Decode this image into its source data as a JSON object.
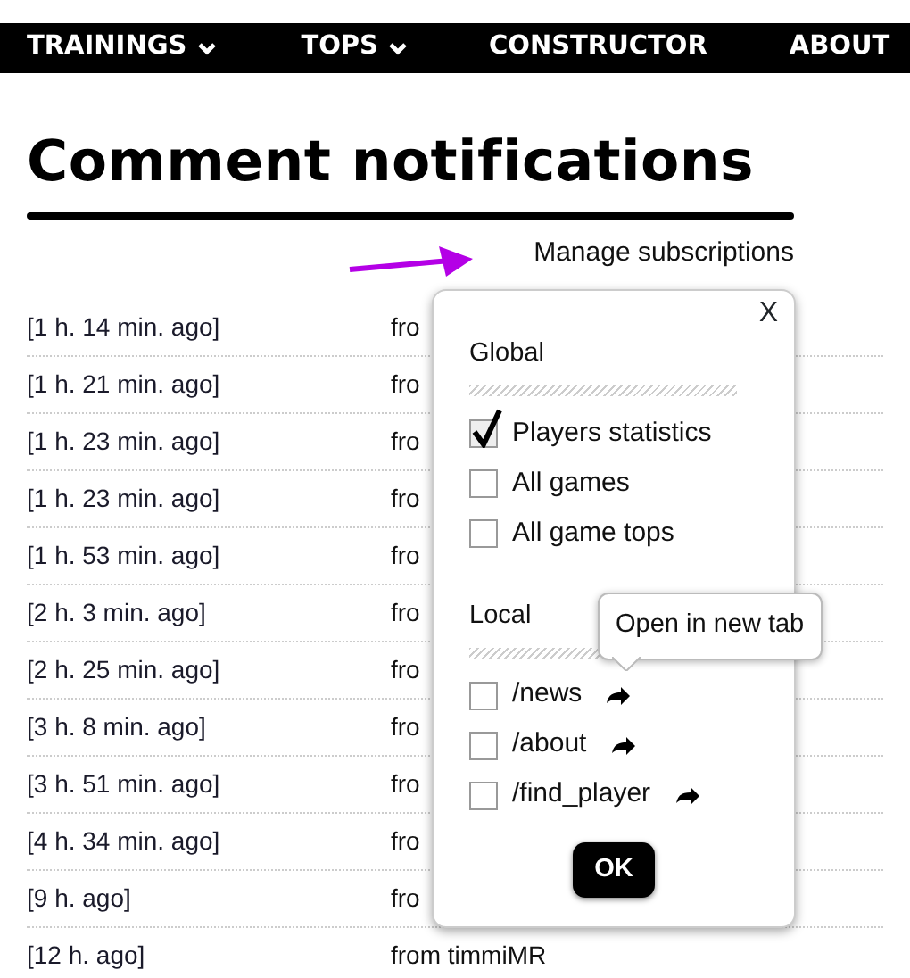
{
  "nav": [
    {
      "label": "TRAININGS",
      "dropdown": true
    },
    {
      "label": "TOPS",
      "dropdown": true
    },
    {
      "label": "CONSTRUCTOR",
      "dropdown": false
    },
    {
      "label": "ABOUT",
      "dropdown": false
    }
  ],
  "title": "Comment notifications",
  "manage_link": "Manage subscriptions",
  "rows": [
    {
      "time": "[1 h. 14 min. ago]",
      "column_2": "fro"
    },
    {
      "time": "[1 h. 21 min. ago]",
      "column_2": "fro"
    },
    {
      "time": "[1 h. 23 min. ago]",
      "column_2": "fro"
    },
    {
      "time": "[1 h. 23 min. ago]",
      "column_2": "fro"
    },
    {
      "time": "[1 h. 53 min. ago]",
      "column_2": "fro"
    },
    {
      "time": "[2 h. 3 min. ago]",
      "column_2": "fro"
    },
    {
      "time": "[2 h. 25 min. ago]",
      "column_2": "fro"
    },
    {
      "time": "[3 h. 8 min. ago]",
      "column_2": "fro"
    },
    {
      "time": "[3 h. 51 min. ago]",
      "column_2": "fro"
    },
    {
      "time": "[4 h. 34 min. ago]",
      "column_2": "fro"
    },
    {
      "time": "[9 h. ago]",
      "column_2": "fro"
    },
    {
      "time": "[12 h. ago]",
      "column_2": "from timmiMR"
    }
  ],
  "popup": {
    "close": "X",
    "sections": [
      {
        "heading": "Global",
        "items": [
          {
            "label": "Players statistics",
            "checked": true,
            "open_link": false
          },
          {
            "label": "All games",
            "checked": false,
            "open_link": false
          },
          {
            "label": "All game tops",
            "checked": false,
            "open_link": false
          }
        ]
      },
      {
        "heading": "Local",
        "items": [
          {
            "label": "/news",
            "checked": false,
            "open_link": true
          },
          {
            "label": "/about",
            "checked": false,
            "open_link": true
          },
          {
            "label": "/find_player",
            "checked": false,
            "open_link": true
          }
        ]
      }
    ],
    "ok": "OK"
  },
  "tooltip": "Open in new tab"
}
